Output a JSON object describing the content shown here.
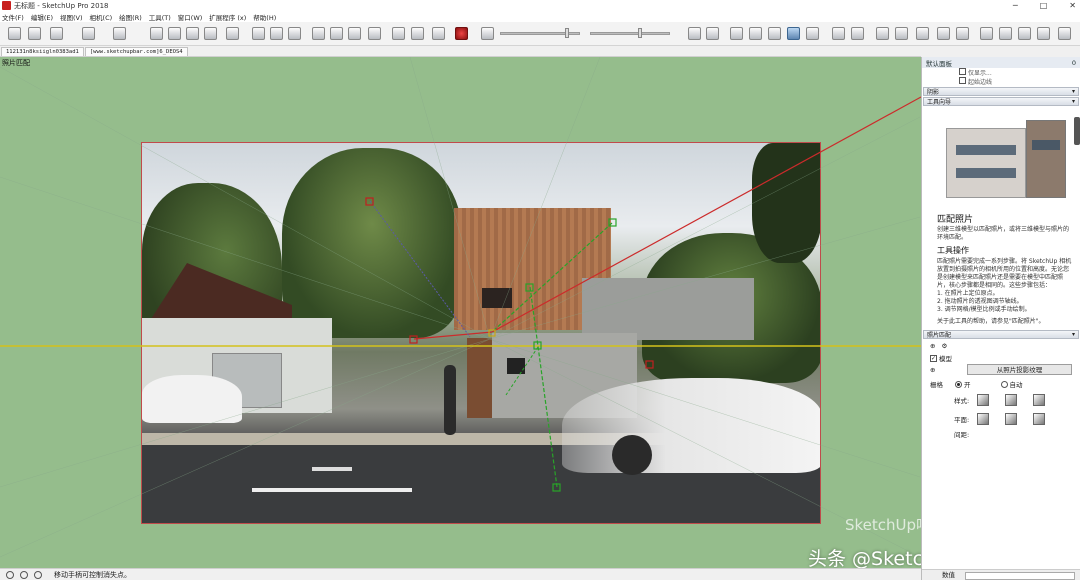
{
  "window": {
    "title": "无标题 - SketchUp Pro 2018",
    "minimize": "─",
    "maximize": "□",
    "close": "✕"
  },
  "menu": [
    "文件(F)",
    "编辑(E)",
    "视图(V)",
    "相机(C)",
    "绘图(R)",
    "工具(T)",
    "窗口(W)",
    "扩展程序 (x)",
    "帮助(H)"
  ],
  "scene_tabs": [
    "112131n8ksiigln0383ad1",
    "[www.sketchupbar.com]6_DEOS4"
  ],
  "viewport": {
    "label": "照片匹配"
  },
  "watermark": {
    "main": "头条 @SketchUp吧",
    "secondary": "SketchUp吧"
  },
  "status": {
    "text": "移动手柄可控制消失点。"
  },
  "panel": {
    "title": "默认面板",
    "pin": "0",
    "checkbox_1": "仅显示...",
    "checkbox_2": "起始边线",
    "section_shadow": "阴影",
    "section_instructor": "工具向导",
    "instructor_title": "匹配照片",
    "instructor_desc": "创建三维模型以匹配照片，或将三维模型与照片的环境匹配。",
    "operation_title": "工具操作",
    "operation_text": "匹配照片需要完成一系列步骤。将 SketchUp 相机放置到拍摄照片的相机所用的位置和高度。无论您是创建模型来匹配照片还是需要在模型中匹配照片，核心步骤都是相同的。这些步骤包括：",
    "steps": [
      "1. 在照片上定位原点。",
      "2. 拖动照片的透视图调节轴线。",
      "3. 调节网格/模型比例或手动绘制。"
    ],
    "help_text": "关于此工具的帮助，请参见\"匹配照片\"。",
    "section_match": "照片匹配",
    "visible_label": "模型",
    "project_button": "从照片投影纹理",
    "grid_label": "栅格",
    "grid_on": "开",
    "grid_auto": "自动",
    "style_label": "样式:",
    "plane_label": "平面:",
    "spacing_label": "间距:",
    "foot_label": "数值"
  }
}
